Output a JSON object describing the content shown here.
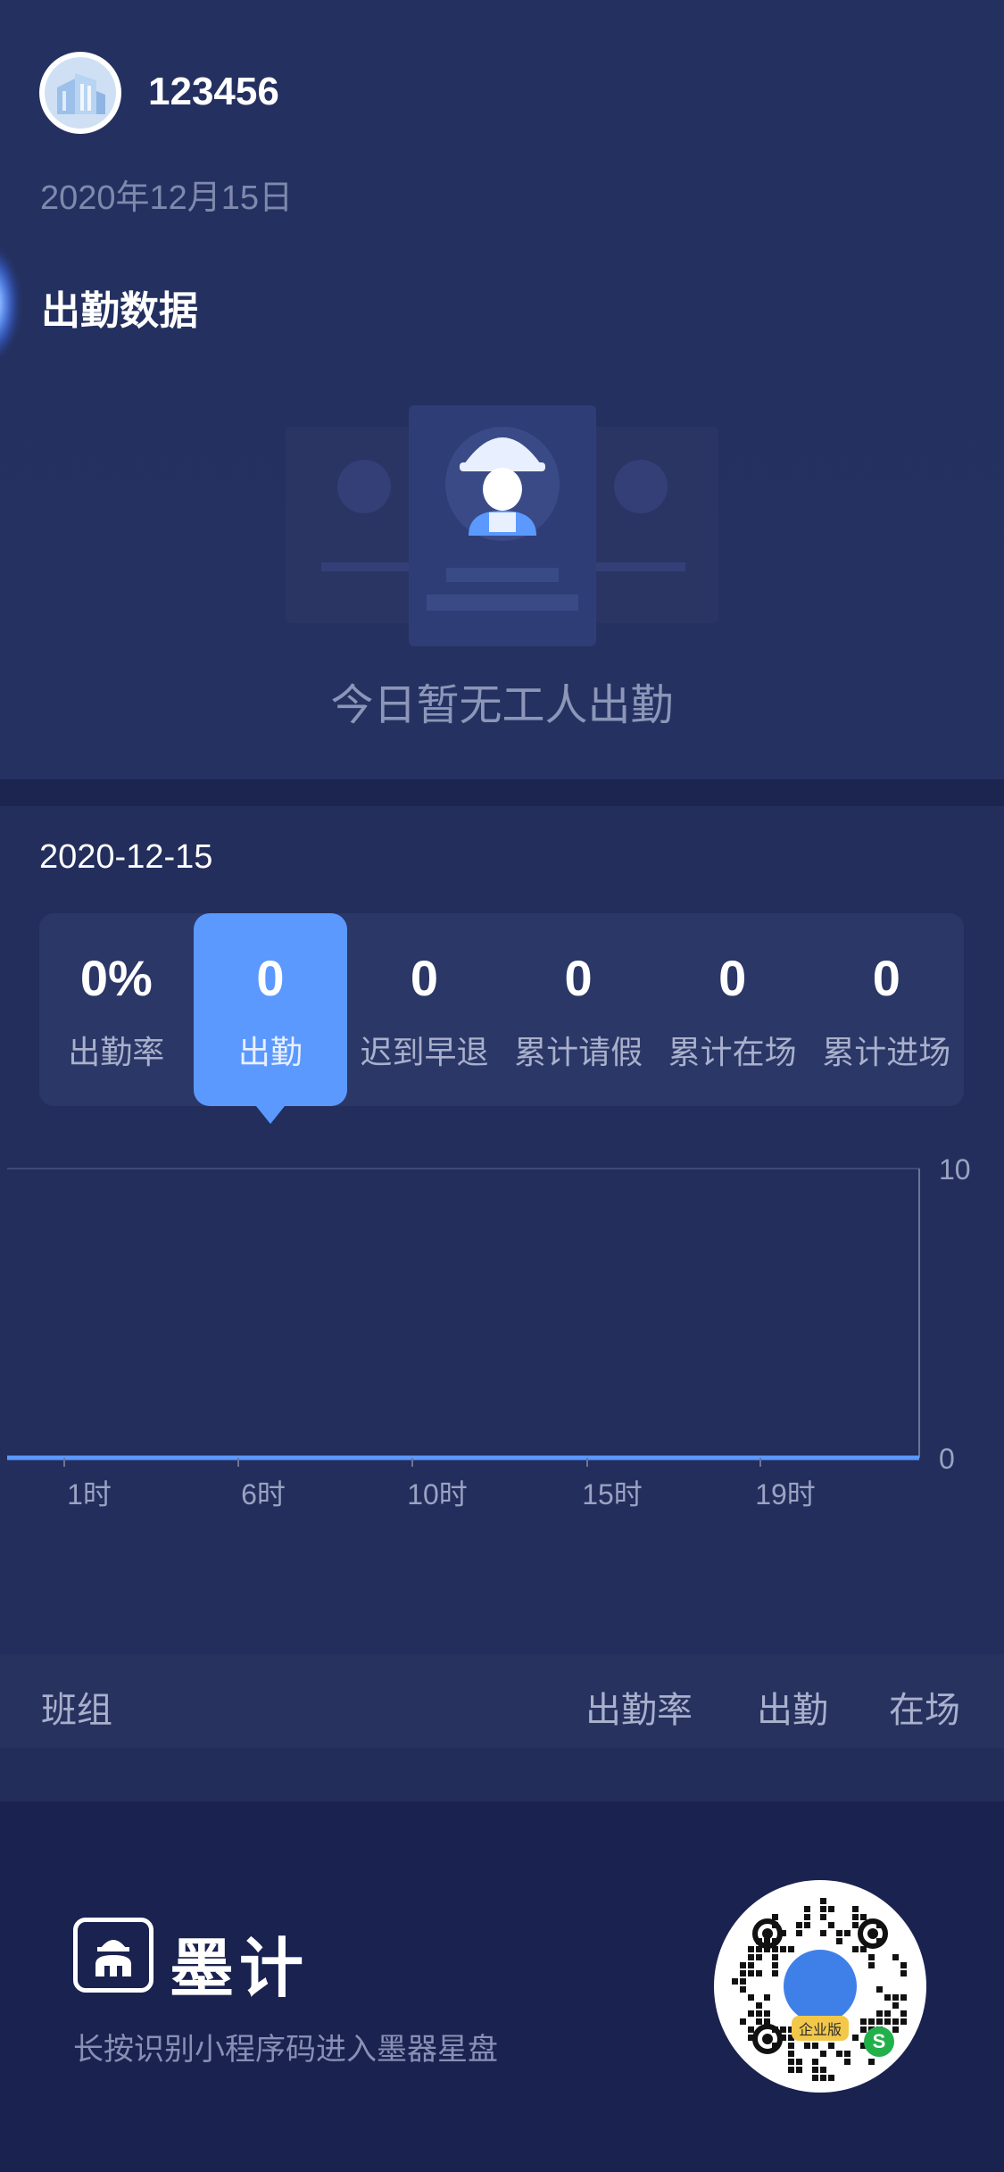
{
  "header": {
    "username": "123456",
    "date": "2020年12月15日",
    "section_title": "出勤数据",
    "empty_text": "今日暂无工人出勤"
  },
  "stats": {
    "date": "2020-12-15",
    "items": [
      {
        "value": "0%",
        "label": "出勤率"
      },
      {
        "value": "0",
        "label": "出勤"
      },
      {
        "value": "0",
        "label": "迟到早退"
      },
      {
        "value": "0",
        "label": "累计请假"
      },
      {
        "value": "0",
        "label": "累计在场"
      },
      {
        "value": "0",
        "label": "累计进场"
      }
    ],
    "active_index": 1
  },
  "chart_data": {
    "type": "line",
    "x": [
      "1时",
      "6时",
      "10时",
      "15时",
      "19时"
    ],
    "series": [
      {
        "values": [
          0,
          0,
          0,
          0,
          0,
          0
        ]
      }
    ],
    "yticks": [
      "10",
      "0"
    ],
    "ylim": [
      0,
      10
    ],
    "y_axis_position": "right",
    "line_color": "#5b99ff"
  },
  "table": {
    "col_group": "班组",
    "col_rate": "出勤率",
    "col_attend": "出勤",
    "col_onsite": "在场"
  },
  "footer": {
    "brand": "墨计",
    "hint": "长按识别小程序码进入墨器星盘",
    "qr_label": "企业版"
  },
  "colors": {
    "background": "#202b55",
    "accent": "#5b99ff",
    "footer": "#1a2250"
  },
  "icons": {
    "avatar": "building-icon",
    "empty": "worker-helmet-icon",
    "logo": "worker-helmet-icon",
    "qr": "qr-code-icon"
  }
}
